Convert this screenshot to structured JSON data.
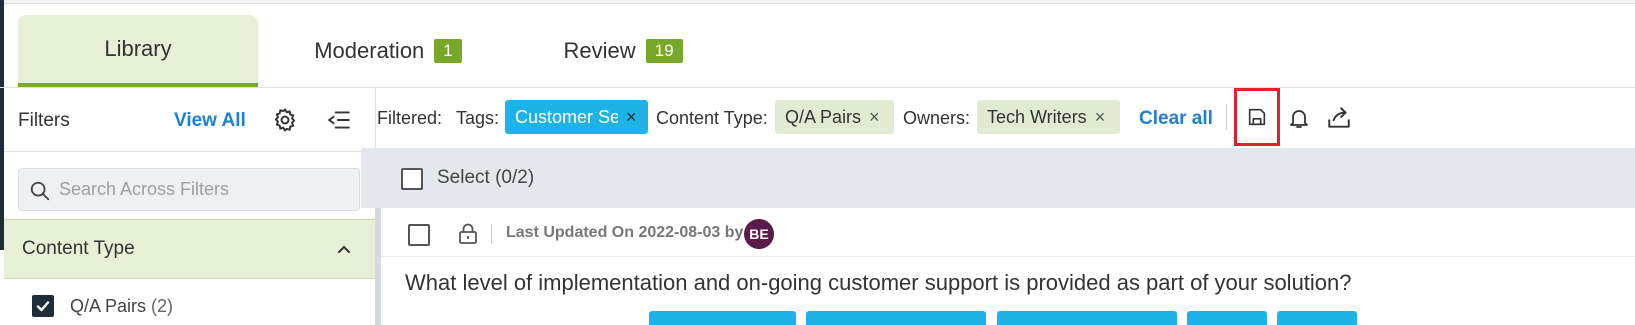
{
  "tabs": [
    {
      "label": "Library",
      "badge": ""
    },
    {
      "label": "Moderation",
      "badge": "1"
    },
    {
      "label": "Review",
      "badge": "19"
    }
  ],
  "sidebar": {
    "title": "Filters",
    "view_all": "View All",
    "search_placeholder": "Search Across Filters",
    "section": {
      "label": "Content Type"
    },
    "items": [
      {
        "label": "Q/A Pairs",
        "count": "(2)",
        "checked": true
      }
    ]
  },
  "filterbar": {
    "filtered_label": "Filtered:",
    "tags_label": "Tags:",
    "tags_value": "Customer Se",
    "content_type_label": "Content Type:",
    "content_type_value": "Q/A Pairs",
    "owners_label": "Owners:",
    "owners_value": "Tech Writers",
    "clear_all": "Clear all",
    "remove_glyph": "×"
  },
  "select_row": {
    "label": "Select (0/2)"
  },
  "card": {
    "meta": "Last Updated On 2022-08-03 by",
    "avatar_initials": "BE",
    "question": "What level of implementation and on-going customer support is provided as part of your solution?"
  },
  "colors": {
    "accent_green": "#78a82a",
    "tab_active_bg": "#e6f0d6",
    "chip_blue": "#1eb3e6",
    "link_blue": "#1d7fd6",
    "highlight_red": "#e3202b",
    "avatar": "#5a1a4a"
  },
  "icons": {
    "gear": "gear-icon",
    "collapse": "collapse-sidebar-icon",
    "search": "search-icon",
    "chevron": "chevron-up-icon",
    "save": "save-icon",
    "bell": "bell-icon",
    "export": "export-icon",
    "lock": "lock-icon"
  }
}
